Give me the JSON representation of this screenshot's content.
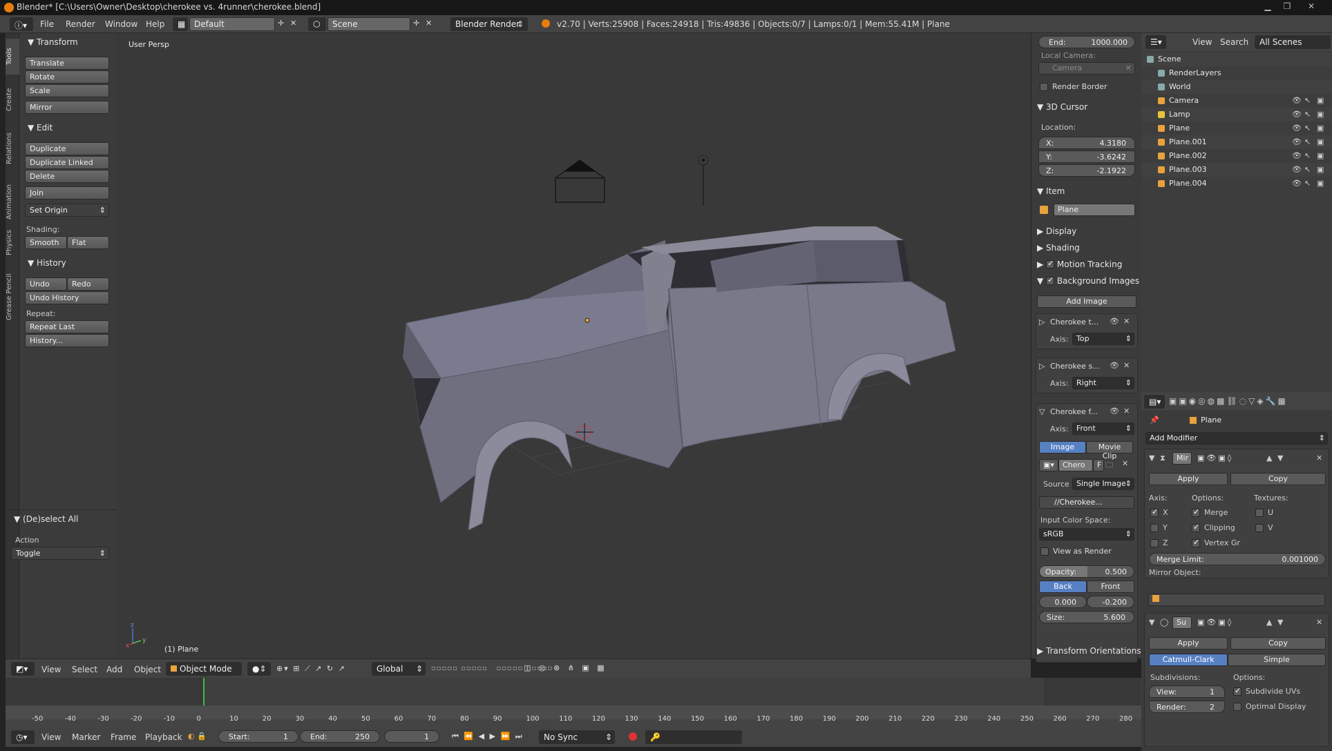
{
  "window": {
    "title": "Blender* [C:\\Users\\Owner\\Desktop\\cherokee vs. 4runner\\cherokee.blend]"
  },
  "infobar": {
    "menus": [
      "File",
      "Render",
      "Window",
      "Help"
    ],
    "layout": "Default",
    "scene": "Scene",
    "engine": "Blender Render",
    "stats": "v2.70 | Verts:25908 | Faces:24918 | Tris:49836 | Objects:0/7 | Lamps:0/1 | Mem:55.41M | Plane"
  },
  "toolshelf": {
    "tabs": [
      "Tools",
      "Create",
      "Relations",
      "Animation",
      "Physics",
      "Grease Pencil"
    ],
    "transform_title": "Transform",
    "translate": "Translate",
    "rotate": "Rotate",
    "scale": "Scale",
    "mirror": "Mirror",
    "edit_title": "Edit",
    "duplicate": "Duplicate",
    "duplicate_linked": "Duplicate Linked",
    "delete": "Delete",
    "join": "Join",
    "set_origin": "Set Origin",
    "shading_label": "Shading:",
    "smooth": "Smooth",
    "flat": "Flat",
    "history_title": "History",
    "undo": "Undo",
    "redo": "Redo",
    "undo_history": "Undo History",
    "repeat_label": "Repeat:",
    "repeat_last": "Repeat Last",
    "history": "History...",
    "operator_title": "(De)select All",
    "action_label": "Action",
    "action_value": "Toggle"
  },
  "viewport": {
    "view_name": "User Persp",
    "object_label": "(1) Plane"
  },
  "npanel": {
    "end_label": "End:",
    "end_value": "1000.000",
    "local_camera": "Local Camera:",
    "camera_placeholder": "Camera",
    "render_border": "Render Border",
    "cursor_title": "3D Cursor",
    "location": "Location:",
    "x_label": "X:",
    "x_value": "4.3180",
    "y_label": "Y:",
    "y_value": "-3.6242",
    "z_label": "Z:",
    "z_value": "-2.1922",
    "item_title": "Item",
    "item_name": "Plane",
    "display": "Display",
    "shading": "Shading",
    "motion_tracking": "Motion Tracking",
    "background_images": "Background Images",
    "add_image": "Add Image",
    "bg1_name": "Cherokee t...",
    "bg1_axis": "Top",
    "bg2_name": "Cherokee s...",
    "bg2_axis": "Right",
    "bg3_name": "Cherokee f...",
    "bg3_axis": "Front",
    "axis_label": "Axis:",
    "image_tab": "Image",
    "movie_tab": "Movie Clip",
    "img_block": "Chero",
    "img_f": "F",
    "source_label": "Source",
    "source_value": "Single Image",
    "filepath": "//Cherokee...",
    "color_space_label": "Input Color Space:",
    "color_space": "sRGB",
    "view_as_render": "View as Render",
    "opacity_label": "Opacity:",
    "opacity_value": "0.500",
    "back": "Back",
    "front": "Front",
    "offset_x": "0.000",
    "offset_y": "-0.200",
    "size_label": "Size:",
    "size_value": "5.600",
    "transform_orientations": "Transform Orientations"
  },
  "outliner": {
    "view": "View",
    "search": "Search",
    "filter": "All Scenes",
    "items": [
      {
        "name": "Scene",
        "icon": "scene-icon"
      },
      {
        "name": "RenderLayers",
        "icon": "renderlayers-icon"
      },
      {
        "name": "World",
        "icon": "world-icon"
      },
      {
        "name": "Camera",
        "icon": "camera-icon"
      },
      {
        "name": "Lamp",
        "icon": "lamp-icon"
      },
      {
        "name": "Plane",
        "icon": "mesh-icon"
      },
      {
        "name": "Plane.001",
        "icon": "mesh-icon"
      },
      {
        "name": "Plane.002",
        "icon": "mesh-icon"
      },
      {
        "name": "Plane.003",
        "icon": "mesh-icon"
      },
      {
        "name": "Plane.004",
        "icon": "mesh-icon"
      }
    ]
  },
  "properties": {
    "object_name": "Plane",
    "add_modifier": "Add Modifier",
    "mirror_name": "Mir",
    "apply": "Apply",
    "copy": "Copy",
    "axis_label": "Axis:",
    "options_label": "Options:",
    "textures_label": "Textures:",
    "x": "X",
    "y": "Y",
    "z": "Z",
    "merge": "Merge",
    "clipping": "Clipping",
    "vertex_gr": "Vertex Gr",
    "u": "U",
    "v": "V",
    "merge_limit_label": "Merge Limit:",
    "merge_limit": "0.001000",
    "mirror_object": "Mirror Object:",
    "subsurf_name": "Su",
    "catmull": "Catmull-Clark",
    "simple": "Simple",
    "subdivisions": "Subdivisions:",
    "options2": "Options:",
    "view_label": "View:",
    "view_value": "1",
    "render_label": "Render:",
    "render_value": "2",
    "subdivide_uvs": "Subdivide UVs",
    "optimal_display": "Optimal Display"
  },
  "viewheader": {
    "menus": [
      "View",
      "Select",
      "Add",
      "Object"
    ],
    "mode": "Object Mode",
    "orientation": "Global"
  },
  "timeline": {
    "ticks": [
      "-50",
      "-40",
      "-30",
      "-20",
      "-10",
      "0",
      "10",
      "20",
      "30",
      "40",
      "50",
      "60",
      "70",
      "80",
      "90",
      "100",
      "110",
      "120",
      "130",
      "140",
      "150",
      "160",
      "170",
      "180",
      "190",
      "200",
      "210",
      "220",
      "230",
      "240",
      "250",
      "260",
      "270",
      "280"
    ],
    "menus": [
      "View",
      "Marker",
      "Frame",
      "Playback"
    ],
    "start_label": "Start:",
    "start_value": "1",
    "end_label": "End:",
    "end_value": "250",
    "current": "1",
    "sync": "No Sync"
  },
  "colors": {
    "accent": "#5680c2",
    "current_frame": "#3fbf3f",
    "blender_orange": "#e87d0d"
  }
}
